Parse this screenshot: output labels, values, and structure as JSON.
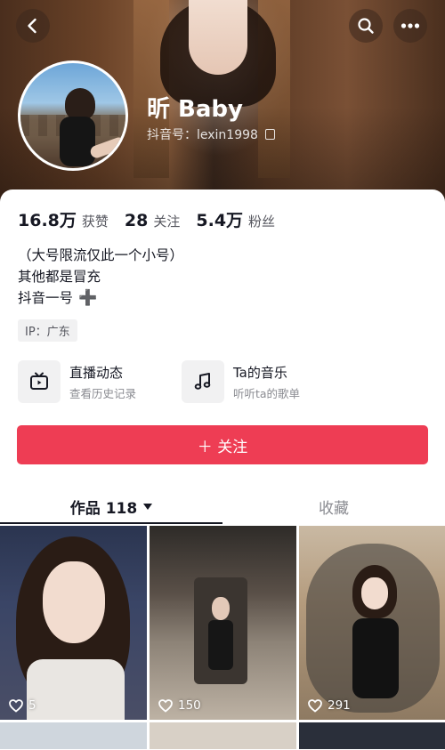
{
  "header": {
    "back_icon": "chevron-left-icon",
    "search_icon": "search-icon",
    "more_icon": "more-icon"
  },
  "profile": {
    "name": "昕 Baby",
    "handle": "抖音号：lexin1998",
    "avatar_icon": "avatar"
  },
  "stats": [
    {
      "value": "16.8万",
      "label": "获赞"
    },
    {
      "value": "28",
      "label": "关注"
    },
    {
      "value": "5.4万",
      "label": "粉丝"
    }
  ],
  "bio": {
    "line1": "（大号限流仅此一个小号）",
    "line2": "其他都是冒充",
    "line3": "抖音一号",
    "line3_emoji": "➕"
  },
  "ip_tag": "IP：广东",
  "cards": [
    {
      "title": "直播动态",
      "subtitle": "查看历史记录",
      "icon": "tv-icon"
    },
    {
      "title": "Ta的音乐",
      "subtitle": "听听ta的歌单",
      "icon": "music-note-icon"
    }
  ],
  "follow_button": "＋ 关注",
  "tabs": {
    "works": "作品 118",
    "favorites": "收藏"
  },
  "videos": [
    {
      "likes": "5"
    },
    {
      "likes": "150"
    },
    {
      "likes": "291"
    }
  ],
  "colors": {
    "accent": "#ee3d54",
    "text": "#161823",
    "secondary": "#8a8b91"
  }
}
